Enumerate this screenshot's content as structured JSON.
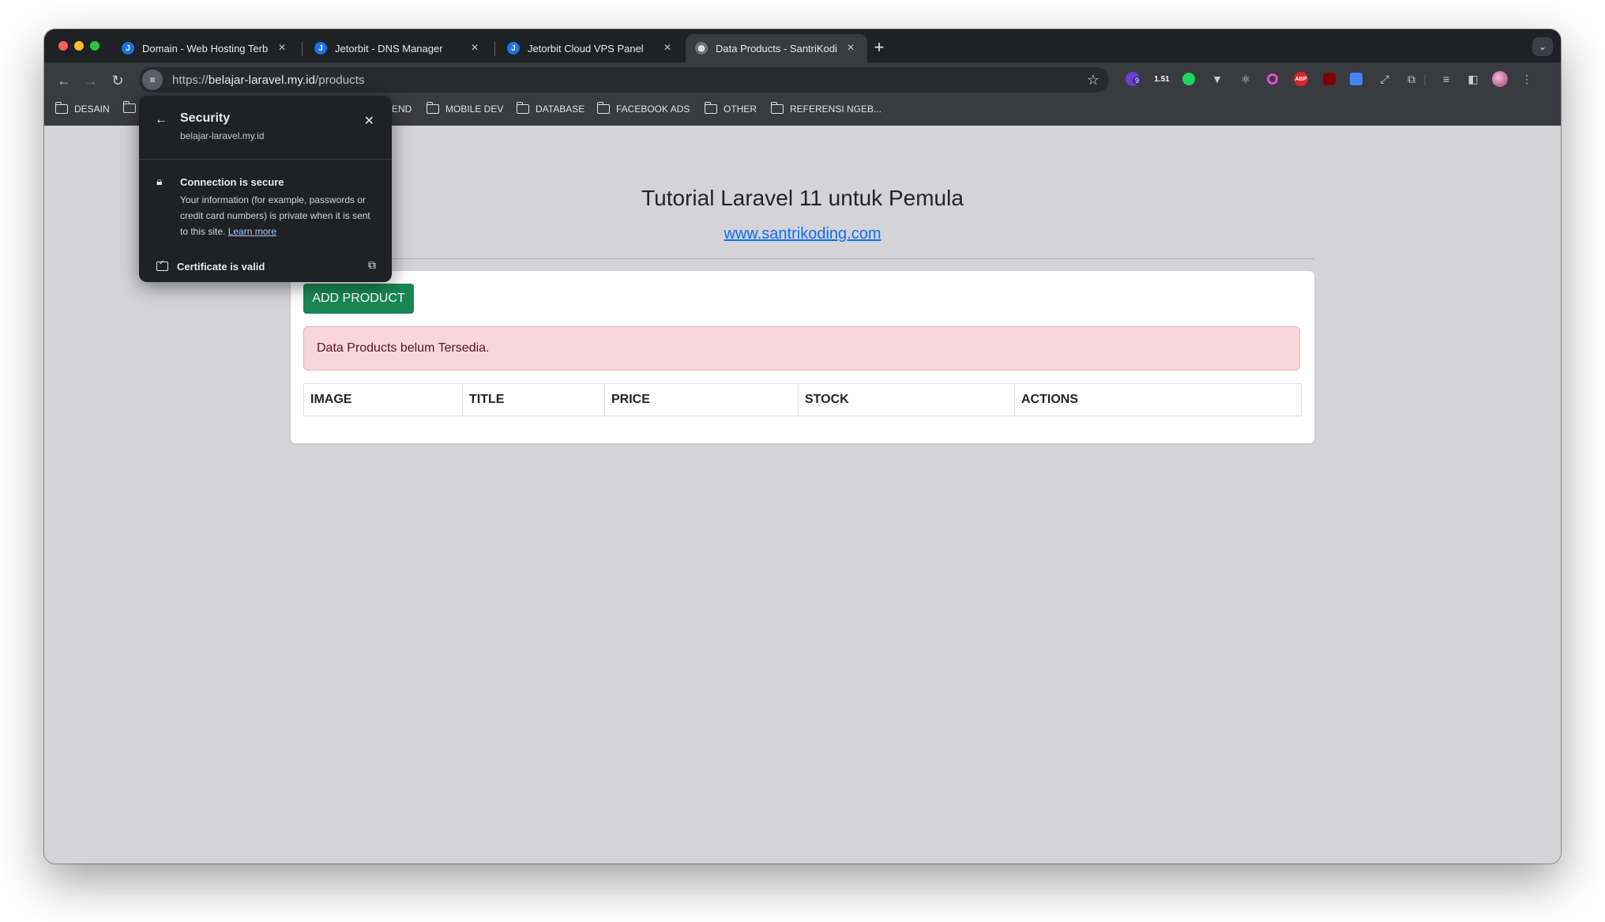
{
  "browser": {
    "tabs": [
      {
        "title": "Domain - Web Hosting Terba",
        "active": false
      },
      {
        "title": "Jetorbit - DNS Manager",
        "active": false
      },
      {
        "title": "Jetorbit Cloud VPS Panel",
        "active": false
      },
      {
        "title": "Data Products - SantriKoding",
        "active": true
      }
    ],
    "url_prefix": "https://",
    "url_host": "belajar-laravel.my.id",
    "url_path": "/products",
    "extensions": {
      "badge_9": "9",
      "badge_151": "1.51",
      "abp": "ABP"
    },
    "bookmarks": [
      "DESAIN",
      "END",
      "MOBILE DEV",
      "DATABASE",
      "FACEBOOK ADS",
      "OTHER",
      "REFERENSI NGEB..."
    ]
  },
  "security_popup": {
    "title": "Security",
    "subtitle": "belajar-laravel.my.id",
    "connection_title": "Connection is secure",
    "connection_body": "Your information (for example, passwords or credit card numbers) is private when it is sent to this site.",
    "learn_more": "Learn more",
    "certificate": "Certificate is valid"
  },
  "page": {
    "title": "Tutorial Laravel 11 untuk Pemula",
    "link": "www.santrikoding.com",
    "add_button": "ADD PRODUCT",
    "alert": "Data Products belum Tersedia.",
    "columns": [
      "IMAGE",
      "TITLE",
      "PRICE",
      "STOCK",
      "ACTIONS"
    ]
  },
  "colors": {
    "add_button": "#198754",
    "alert_bg": "#f8d7da",
    "link": "#0d6efd"
  }
}
